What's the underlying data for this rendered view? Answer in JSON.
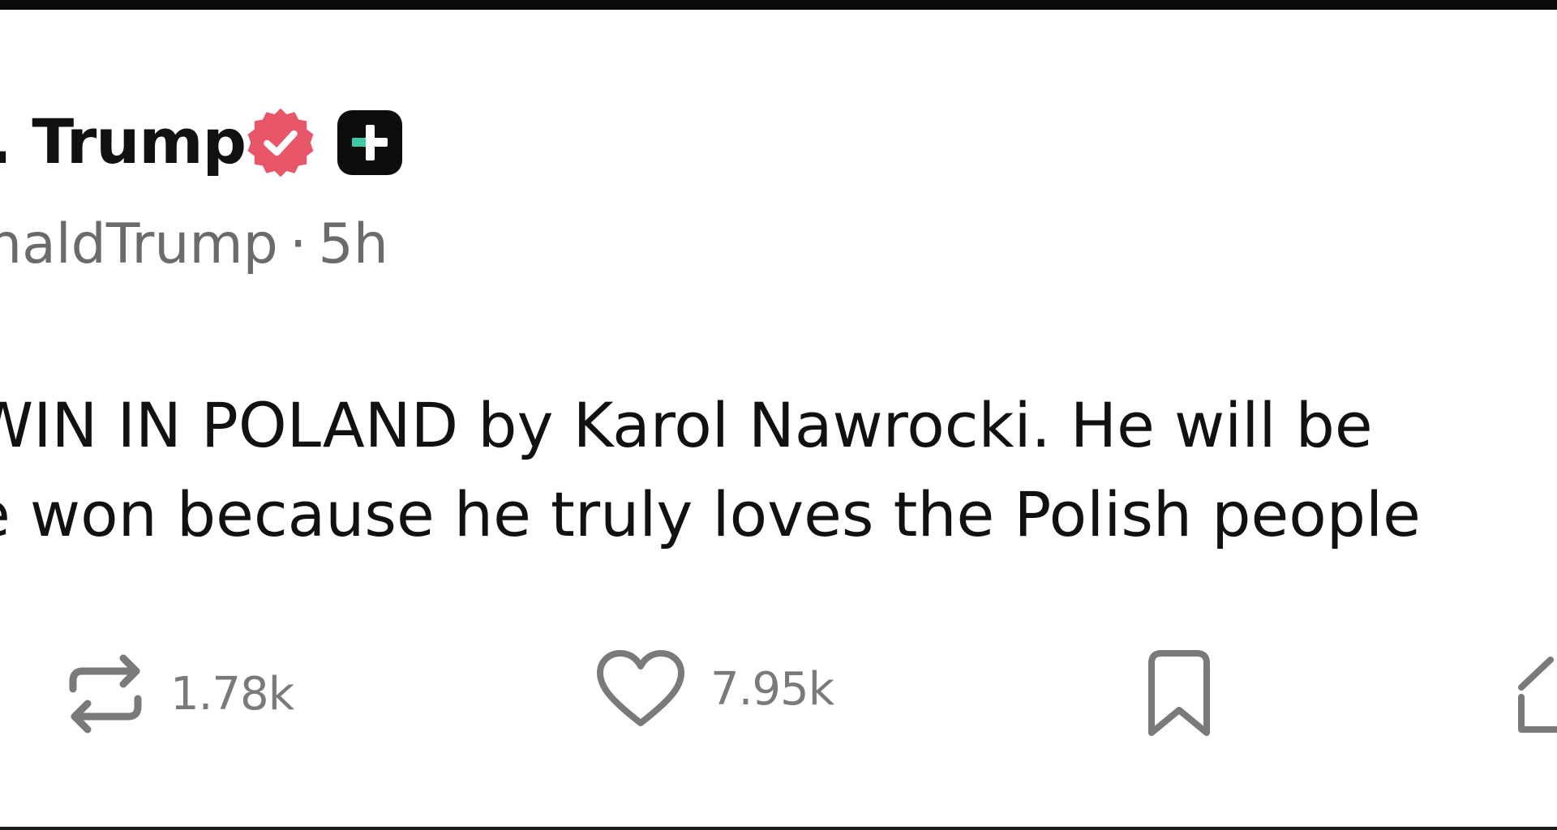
{
  "post": {
    "display_name": ". Trump",
    "handle": "naldTrump",
    "separator": "·",
    "time_ago": "5h",
    "text_lines": [
      "WIN IN POLAND by Karol Nawrocki. He will be",
      "e won because he truly loves the Polish people"
    ]
  },
  "actions": {
    "repost_count": "1.78k",
    "like_count": "7.95k"
  },
  "colors": {
    "verified_badge": "#e8566a",
    "plus_badge_bg": "#0d0d0d",
    "plus_badge_accent": "#3ec9a7",
    "icon_gray": "#7a7a7a"
  },
  "icons": {
    "verified": "verified-badge-icon",
    "plus": "plus-badge-icon",
    "repost": "repost-icon",
    "like": "heart-icon",
    "bookmark": "bookmark-icon",
    "share": "share-icon"
  }
}
